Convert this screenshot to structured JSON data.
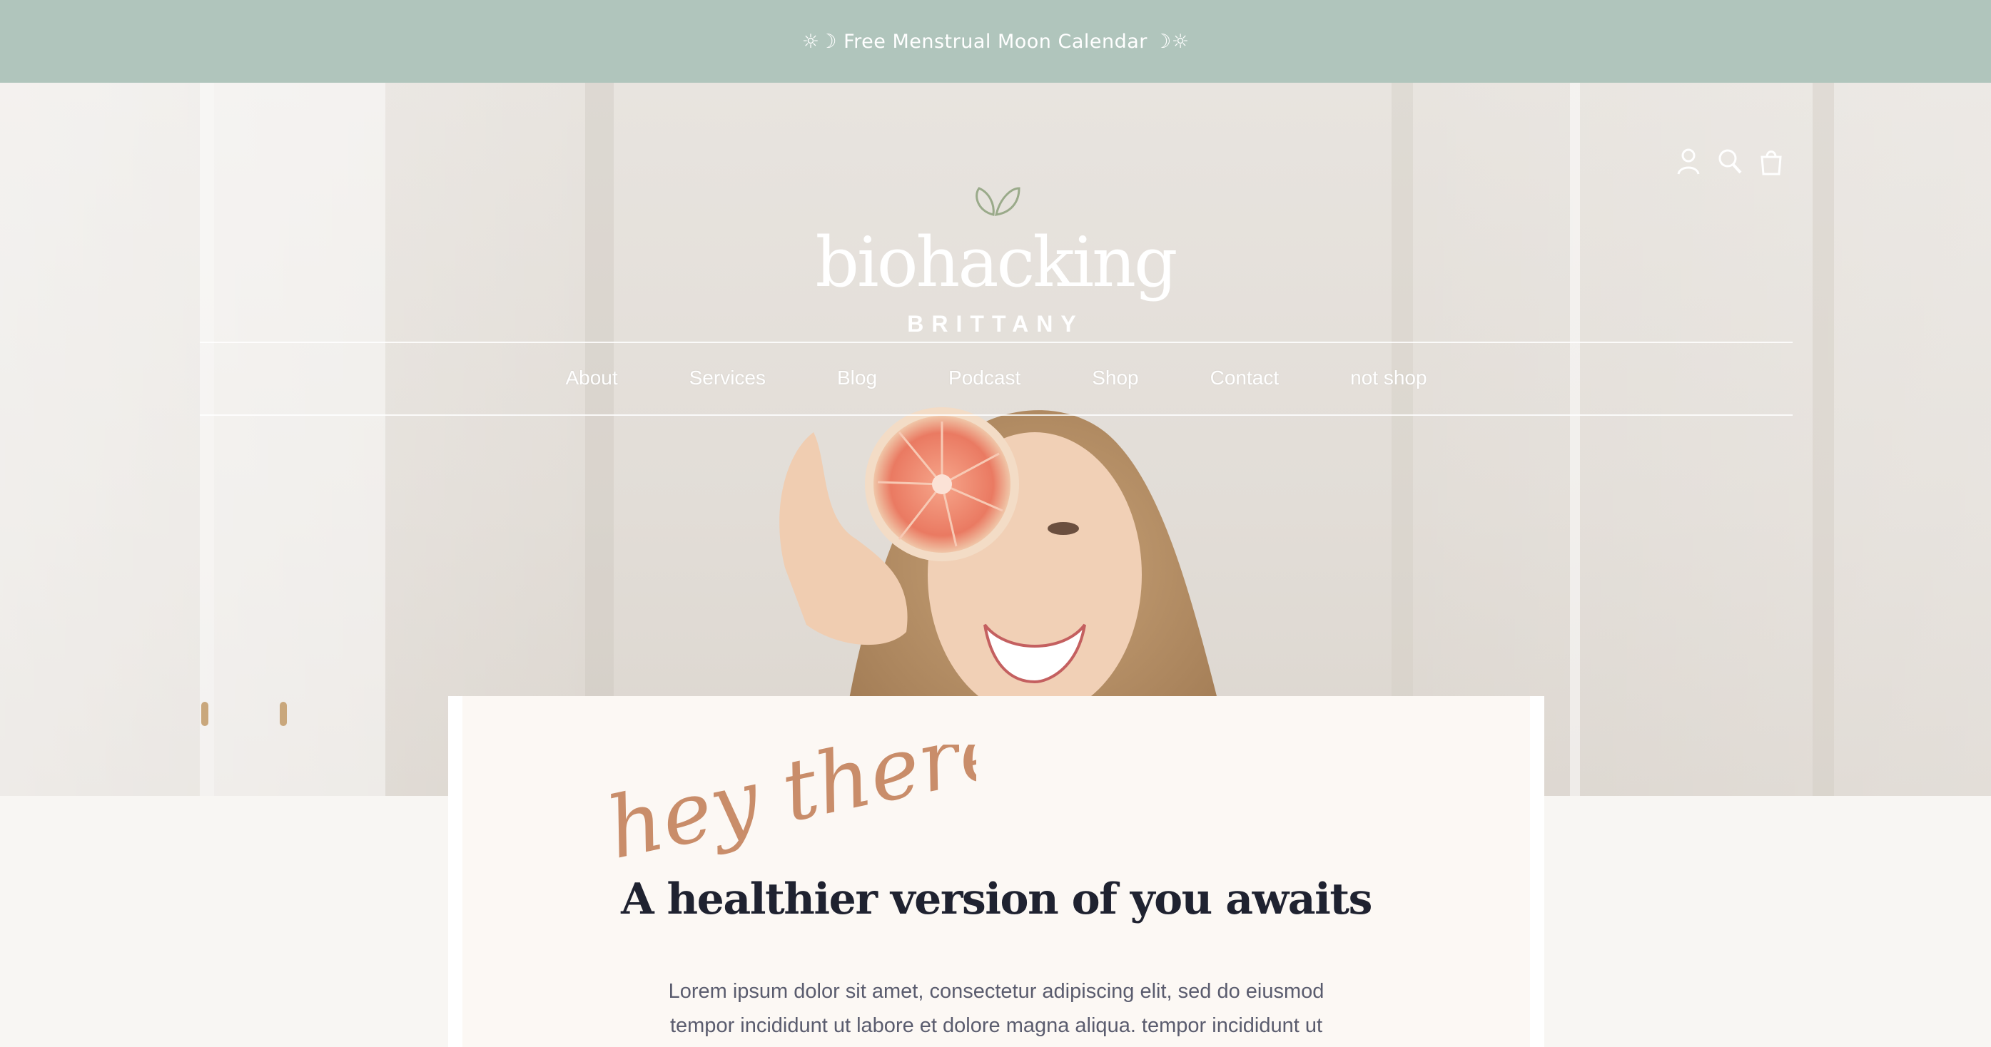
{
  "announcement": {
    "text": "☼☽ Free Menstrual Moon Calendar ☽☼"
  },
  "header": {
    "utility_icons": [
      "account-icon",
      "search-icon",
      "cart-icon"
    ],
    "logo": {
      "wordmark": "biohacking",
      "subtitle": "BRITTANY",
      "leaf_color": "#9aaa8a"
    }
  },
  "nav": {
    "items": [
      {
        "label": "About"
      },
      {
        "label": "Services"
      },
      {
        "label": "Blog"
      },
      {
        "label": "Podcast"
      },
      {
        "label": "Shop"
      },
      {
        "label": "Contact"
      },
      {
        "label": "not shop"
      }
    ]
  },
  "intro": {
    "script": "hey there!",
    "headline": "A healthier version of you awaits",
    "body": "Lorem ipsum dolor sit amet, consectetur adipiscing elit, sed do eiusmod tempor incididunt ut labore et dolore magna aliqua. tempor incididunt ut"
  },
  "colors": {
    "announcement_bg": "#b0c5bc",
    "script_accent": "#c98d6a",
    "headline": "#1f2230",
    "body": "#5a5c6e"
  }
}
